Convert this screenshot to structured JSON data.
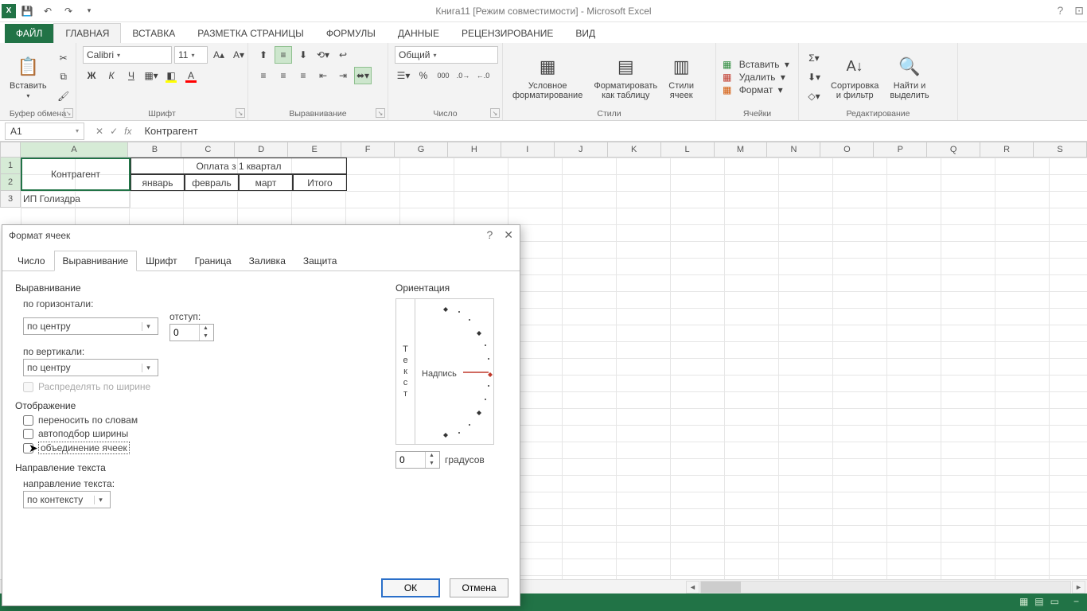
{
  "app": {
    "title": "Книга11  [Режим совместимости] - Microsoft Excel",
    "excel_abbrev": "X"
  },
  "ribbon": {
    "file": "ФАЙЛ",
    "tabs": [
      "ГЛАВНАЯ",
      "ВСТАВКА",
      "РАЗМЕТКА СТРАНИЦЫ",
      "ФОРМУЛЫ",
      "ДАННЫЕ",
      "РЕЦЕНЗИРОВАНИЕ",
      "ВИД"
    ],
    "active_tab": 0,
    "groups": {
      "clipboard": {
        "label": "Буфер обмена",
        "paste": "Вставить"
      },
      "font": {
        "label": "Шрифт",
        "name": "Calibri",
        "size": "11"
      },
      "alignment": {
        "label": "Выравнивание"
      },
      "number": {
        "label": "Число",
        "format": "Общий"
      },
      "styles": {
        "label": "Стили",
        "cond": "Условное\nформатирование",
        "table": "Форматировать\nкак таблицу",
        "cell": "Стили\nячеек"
      },
      "cells": {
        "label": "Ячейки",
        "insert": "Вставить",
        "delete": "Удалить",
        "format": "Формат"
      },
      "editing": {
        "label": "Редактирование",
        "sort": "Сортировка\nи фильтр",
        "find": "Найти и\nвыделить"
      }
    }
  },
  "formula": {
    "name": "A1",
    "value": "Контрагент"
  },
  "columns": [
    "A",
    "B",
    "C",
    "D",
    "E",
    "F",
    "G",
    "H",
    "I",
    "J",
    "K",
    "L",
    "M",
    "N",
    "O",
    "P",
    "Q",
    "R",
    "S"
  ],
  "sheet": {
    "a1": "Контрагент",
    "b1": "Оплата з 1 квартал",
    "b2": "январь",
    "c2": "февраль",
    "d2": "март",
    "e2": "Итого",
    "a3": "ИП Голиздра"
  },
  "dialog": {
    "title": "Формат ячеек",
    "tabs": [
      "Число",
      "Выравнивание",
      "Шрифт",
      "Граница",
      "Заливка",
      "Защита"
    ],
    "active_tab": 1,
    "section_align": "Выравнивание",
    "h_label": "по горизонтали:",
    "h_value": "по центру",
    "indent_label": "отступ:",
    "indent_value": "0",
    "v_label": "по вертикали:",
    "v_value": "по центру",
    "distribute": "Распределять по ширине",
    "section_display": "Отображение",
    "wrap": "переносить по словам",
    "shrink": "автоподбор ширины",
    "merge": "объединение ячеек",
    "section_dir": "Направление текста",
    "dir_label": "направление текста:",
    "dir_value": "по контексту",
    "section_orient": "Ориентация",
    "orient_vtext": "Текст",
    "orient_htext": "Надпись",
    "degrees_value": "0",
    "degrees_label": "градусов",
    "ok": "ОК",
    "cancel": "Отмена"
  }
}
